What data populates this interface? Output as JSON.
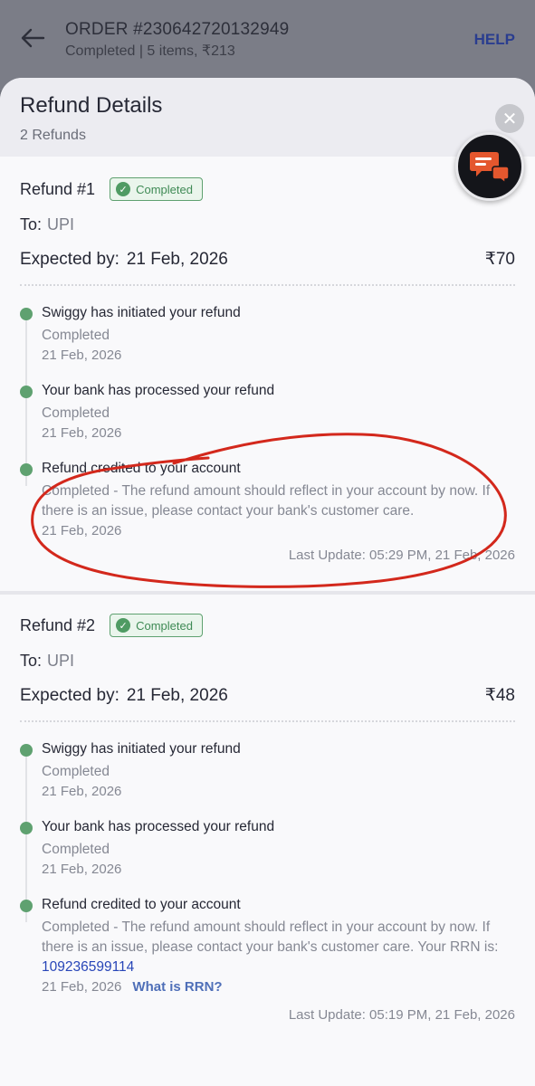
{
  "header": {
    "order_title": "ORDER #230642720132949",
    "order_subtitle": "Completed | 5 items, ₹213",
    "help_label": "HELP"
  },
  "sheet": {
    "title": "Refund Details",
    "count": "2 Refunds"
  },
  "refunds": [
    {
      "name": "Refund #1",
      "badge": "Completed",
      "to_label": "To:",
      "to_value": "UPI",
      "expected_label": "Expected by:",
      "expected_date": "21 Feb, 2026",
      "amount": "₹70",
      "steps": [
        {
          "title": "Swiggy has initiated your refund",
          "status": "Completed",
          "date": "21 Feb, 2026"
        },
        {
          "title": "Your bank has processed your refund",
          "status": "Completed",
          "date": "21 Feb, 2026"
        },
        {
          "title": "Refund credited to your account",
          "status": "Completed - The refund amount should reflect in your account by now. If there is an issue, please contact your bank's customer care.",
          "date": "21 Feb, 2026"
        }
      ],
      "last_update": "Last Update: 05:29 PM, 21 Feb, 2026"
    },
    {
      "name": "Refund #2",
      "badge": "Completed",
      "to_label": "To:",
      "to_value": "UPI",
      "expected_label": "Expected by:",
      "expected_date": "21 Feb, 2026",
      "amount": "₹48",
      "steps": [
        {
          "title": "Swiggy has initiated your refund",
          "status": "Completed",
          "date": "21 Feb, 2026"
        },
        {
          "title": "Your bank has processed your refund",
          "status": "Completed",
          "date": "21 Feb, 2026"
        },
        {
          "title": "Refund credited to your account",
          "status": "Completed - The refund amount should reflect in your account by now. If there is an issue, please contact your bank's customer care. Your RRN is:",
          "rrn": "109236599114",
          "date": "21 Feb, 2026",
          "rrn_link": "What is RRN?"
        }
      ],
      "last_update": "Last Update: 05:19 PM, 21 Feb, 2026"
    }
  ],
  "icons": {
    "back": "back-arrow-icon",
    "close": "close-icon",
    "chat": "chat-support-icon",
    "check": "check-circle-icon"
  },
  "colors": {
    "status_green": "#5fa170",
    "help_blue": "#2a3d8f",
    "rrn_blue": "#2846b8",
    "annotation_red": "#d3281c"
  }
}
